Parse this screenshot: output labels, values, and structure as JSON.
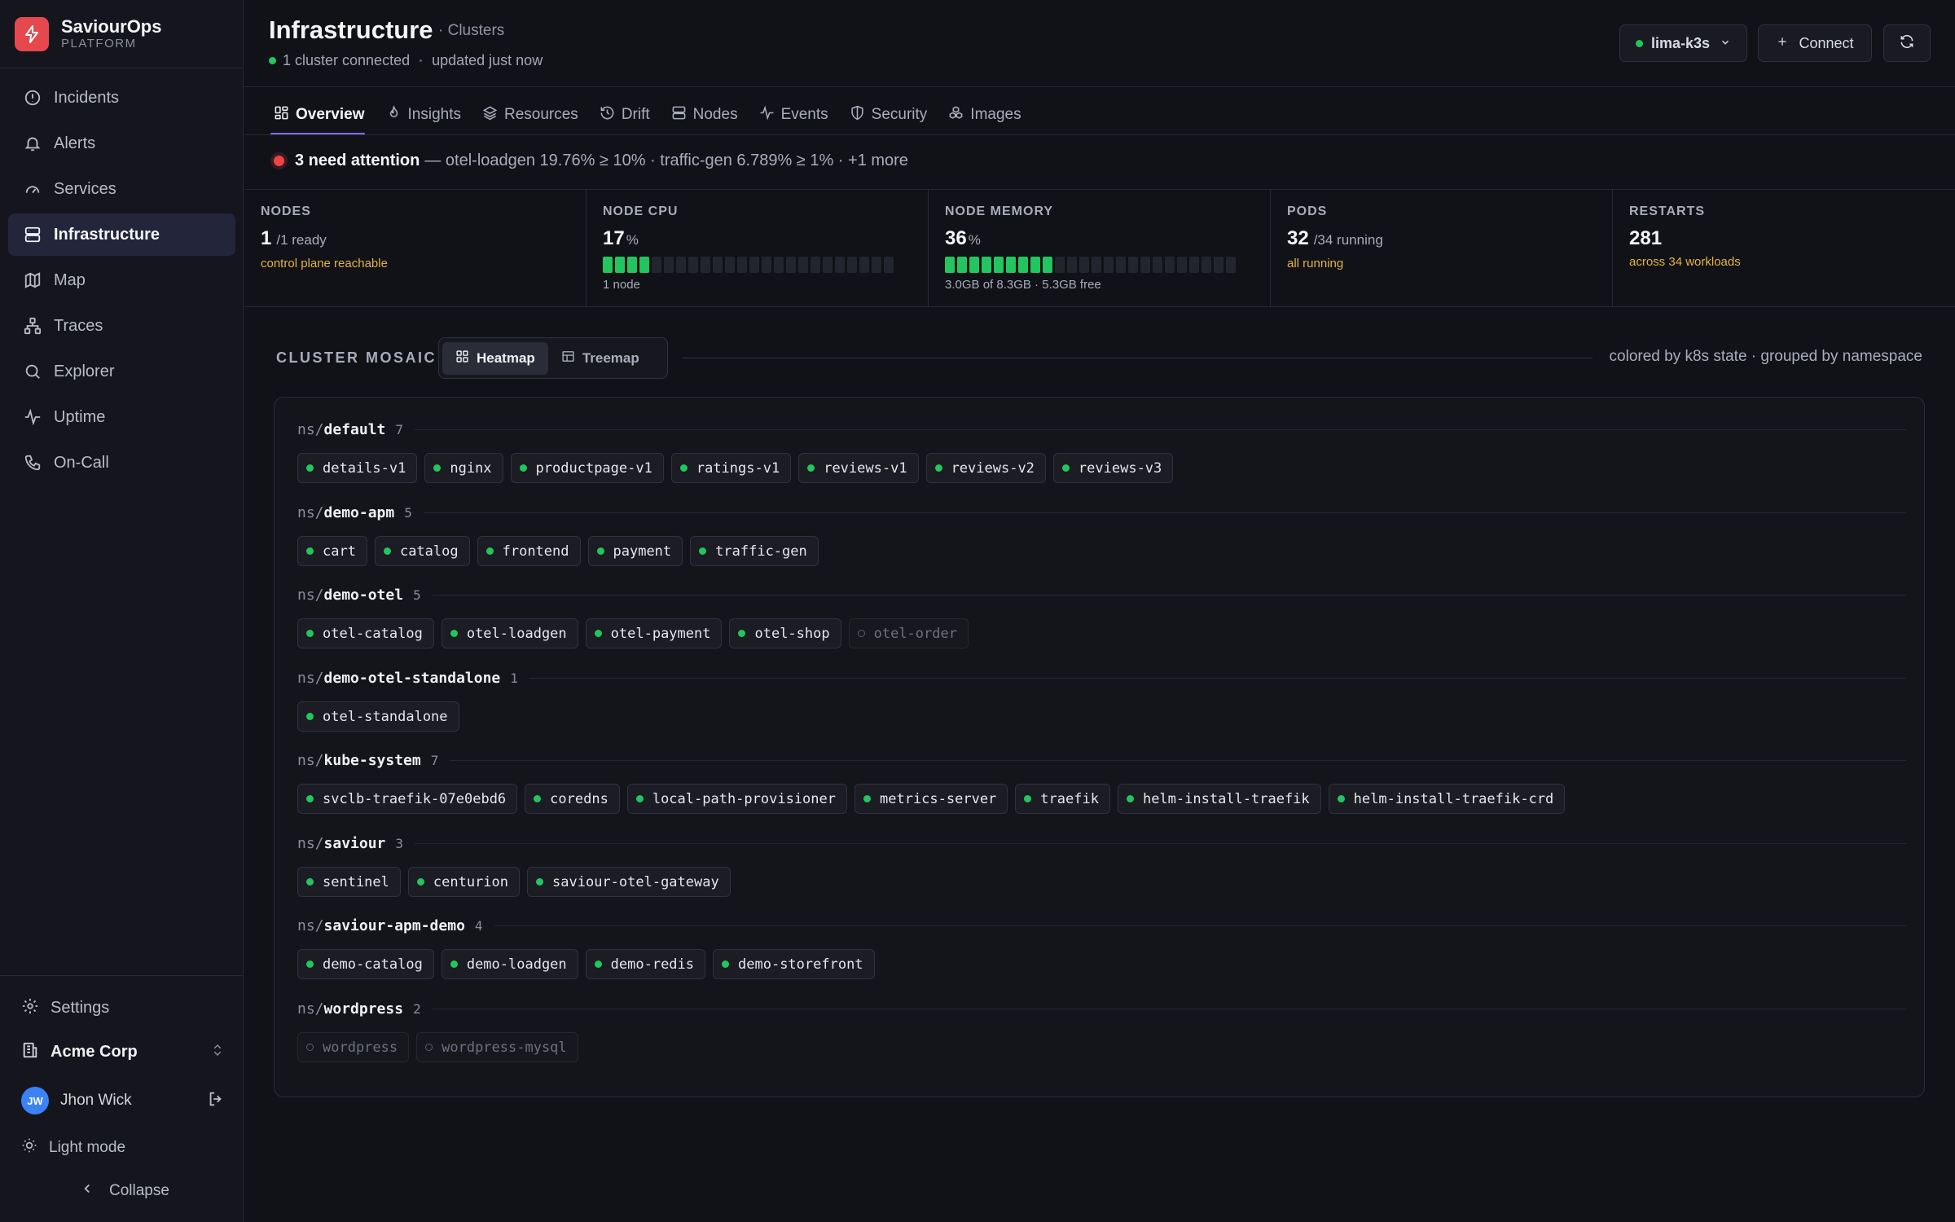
{
  "brand": {
    "name": "SaviourOps",
    "sub": "PLATFORM"
  },
  "nav": [
    {
      "label": "Incidents",
      "icon": "alert-circle-icon"
    },
    {
      "label": "Alerts",
      "icon": "bell-icon"
    },
    {
      "label": "Services",
      "icon": "gauge-icon"
    },
    {
      "label": "Infrastructure",
      "icon": "server-icon",
      "active": true
    },
    {
      "label": "Map",
      "icon": "map-icon"
    },
    {
      "label": "Traces",
      "icon": "network-icon"
    },
    {
      "label": "Explorer",
      "icon": "search-icon"
    },
    {
      "label": "Uptime",
      "icon": "activity-icon"
    },
    {
      "label": "On-Call",
      "icon": "phone-icon"
    }
  ],
  "sidebar_bottom": {
    "settings": "Settings",
    "org": "Acme Corp",
    "user_initials": "JW",
    "user_name": "Jhon Wick",
    "light_mode": "Light mode",
    "collapse": "Collapse"
  },
  "header": {
    "title": "Infrastructure",
    "crumb": "· Clusters",
    "connected": "1 cluster connected",
    "updated": "updated just now",
    "context": "lima-k3s",
    "connect": "Connect"
  },
  "tabs": [
    {
      "label": "Overview",
      "icon": "grid-icon",
      "active": true
    },
    {
      "label": "Insights",
      "icon": "flame-icon"
    },
    {
      "label": "Resources",
      "icon": "layers-icon"
    },
    {
      "label": "Drift",
      "icon": "history-icon"
    },
    {
      "label": "Nodes",
      "icon": "server-icon"
    },
    {
      "label": "Events",
      "icon": "activity-icon"
    },
    {
      "label": "Security",
      "icon": "shield-icon"
    },
    {
      "label": "Images",
      "icon": "boxes-icon"
    }
  ],
  "attention": {
    "strong": "3 need attention",
    "rest": "— otel-loadgen 19.76% ≥ 10% · traffic-gen 6.789% ≥ 1% · +1 more"
  },
  "stats": {
    "nodes": {
      "label": "NODES",
      "value": "1",
      "unit": "/1 ready",
      "sub": "control plane reachable"
    },
    "cpu": {
      "label": "NODE CPU",
      "value": "17",
      "unit": "%",
      "sub": "1 node",
      "percent": 17
    },
    "memory": {
      "label": "NODE MEMORY",
      "value": "36",
      "unit": "%",
      "sub": "3.0GB of 8.3GB · 5.3GB free",
      "percent": 36
    },
    "pods": {
      "label": "PODS",
      "value": "32",
      "unit": "/34 running",
      "sub": "all running"
    },
    "restarts": {
      "label": "RESTARTS",
      "value": "281",
      "sub": "across 34 workloads"
    }
  },
  "mosaic": {
    "title": "CLUSTER MOSAIC",
    "heatmap": "Heatmap",
    "treemap": "Treemap",
    "note": "colored by k8s state · grouped by namespace"
  },
  "namespaces": [
    {
      "prefix": "ns/",
      "name": "default",
      "count": "7",
      "workloads": [
        {
          "name": "details-v1",
          "ok": true
        },
        {
          "name": "nginx",
          "ok": true
        },
        {
          "name": "productpage-v1",
          "ok": true
        },
        {
          "name": "ratings-v1",
          "ok": true
        },
        {
          "name": "reviews-v1",
          "ok": true
        },
        {
          "name": "reviews-v2",
          "ok": true
        },
        {
          "name": "reviews-v3",
          "ok": true
        }
      ]
    },
    {
      "prefix": "ns/",
      "name": "demo-apm",
      "count": "5",
      "workloads": [
        {
          "name": "cart",
          "ok": true
        },
        {
          "name": "catalog",
          "ok": true
        },
        {
          "name": "frontend",
          "ok": true
        },
        {
          "name": "payment",
          "ok": true
        },
        {
          "name": "traffic-gen",
          "ok": true
        }
      ]
    },
    {
      "prefix": "ns/",
      "name": "demo-otel",
      "count": "5",
      "workloads": [
        {
          "name": "otel-catalog",
          "ok": true
        },
        {
          "name": "otel-loadgen",
          "ok": true
        },
        {
          "name": "otel-payment",
          "ok": true
        },
        {
          "name": "otel-shop",
          "ok": true
        },
        {
          "name": "otel-order",
          "ok": false
        }
      ]
    },
    {
      "prefix": "ns/",
      "name": "demo-otel-standalone",
      "count": "1",
      "workloads": [
        {
          "name": "otel-standalone",
          "ok": true
        }
      ]
    },
    {
      "prefix": "ns/",
      "name": "kube-system",
      "count": "7",
      "workloads": [
        {
          "name": "svclb-traefik-07e0ebd6",
          "ok": true
        },
        {
          "name": "coredns",
          "ok": true
        },
        {
          "name": "local-path-provisioner",
          "ok": true
        },
        {
          "name": "metrics-server",
          "ok": true
        },
        {
          "name": "traefik",
          "ok": true
        },
        {
          "name": "helm-install-traefik",
          "ok": true
        },
        {
          "name": "helm-install-traefik-crd",
          "ok": true
        }
      ]
    },
    {
      "prefix": "ns/",
      "name": "saviour",
      "count": "3",
      "workloads": [
        {
          "name": "sentinel",
          "ok": true
        },
        {
          "name": "centurion",
          "ok": true
        },
        {
          "name": "saviour-otel-gateway",
          "ok": true
        }
      ]
    },
    {
      "prefix": "ns/",
      "name": "saviour-apm-demo",
      "count": "4",
      "workloads": [
        {
          "name": "demo-catalog",
          "ok": true
        },
        {
          "name": "demo-loadgen",
          "ok": true
        },
        {
          "name": "demo-redis",
          "ok": true
        },
        {
          "name": "demo-storefront",
          "ok": true
        }
      ]
    },
    {
      "prefix": "ns/",
      "name": "wordpress",
      "count": "2",
      "workloads": [
        {
          "name": "wordpress",
          "ok": false
        },
        {
          "name": "wordpress-mysql",
          "ok": false
        }
      ]
    }
  ],
  "colors": {
    "accent": "#7c6cf2",
    "ok": "#22c55e",
    "danger": "#ef4444",
    "warn": "#e3b341",
    "brand": "#e5484d"
  }
}
